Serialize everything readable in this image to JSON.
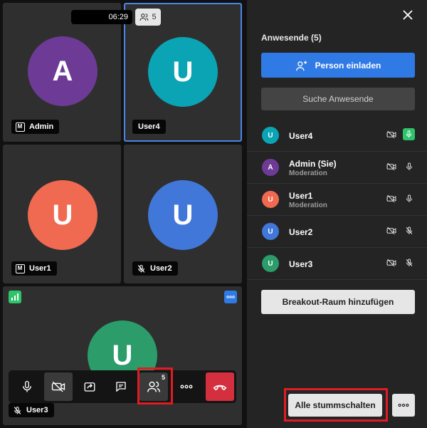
{
  "meeting": {
    "timer": "06:29",
    "participant_count": "5"
  },
  "tiles": [
    {
      "initial": "A",
      "name": "Admin",
      "color": "#6d3a96",
      "moderator_badge": "M"
    },
    {
      "initial": "U",
      "name": "User4",
      "color": "#0aa4b4",
      "active_speaker": true
    },
    {
      "initial": "U",
      "name": "User1",
      "color": "#ef6a50",
      "moderator_badge": "M"
    },
    {
      "initial": "U",
      "name": "User2",
      "color": "#4177d8",
      "muted": true
    },
    {
      "initial": "U",
      "name": "User3",
      "color": "#2b9c6a",
      "muted": true
    }
  ],
  "toolbar": {
    "participants_badge": "5",
    "icons": [
      "microphone-icon",
      "camera-off-icon",
      "share-screen-icon",
      "chat-icon",
      "participants-icon",
      "more-icon",
      "hangup-icon"
    ]
  },
  "sidebar": {
    "title": "Anwesende (5)",
    "invite_label": "Person einladen",
    "search_placeholder": "Suche Anwesende",
    "participants": [
      {
        "initial": "U",
        "name": "User4",
        "role": "",
        "color": "#0aa4b4",
        "mic": "speaking"
      },
      {
        "initial": "A",
        "name": "Admin (Sie)",
        "role": "Moderation",
        "color": "#6d3a96",
        "mic": "on"
      },
      {
        "initial": "U",
        "name": "User1",
        "role": "Moderation",
        "color": "#ef6a50",
        "mic": "on"
      },
      {
        "initial": "U",
        "name": "User2",
        "role": "",
        "color": "#4177d8",
        "mic": "muted"
      },
      {
        "initial": "U",
        "name": "User3",
        "role": "",
        "color": "#2b9c6a",
        "mic": "muted"
      }
    ],
    "breakout_label": "Breakout-Raum hinzufügen",
    "mute_all_label": "Alle stummschalten"
  }
}
